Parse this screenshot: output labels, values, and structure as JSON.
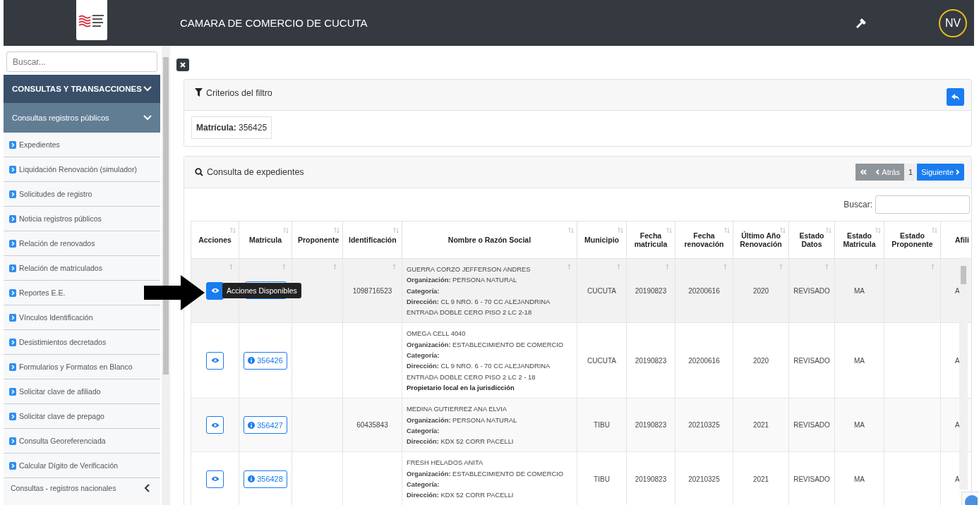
{
  "header": {
    "title": "CAMARA DE COMERCIO DE CUCUTA",
    "avatar": "NV"
  },
  "sidebar": {
    "search": {
      "placeholder": "Buscar..."
    },
    "section": {
      "label": "CONSULTAS Y TRANSACCIONES",
      "expanded": true
    },
    "subsection": {
      "label": "Consultas registros públicos",
      "expanded": true
    },
    "items": [
      "Expedientes",
      "Liquidación Renovación (simulador)",
      "Solicitudes de registro",
      "Noticia registros públicos",
      "Relación de renovados",
      "Relación de matriculados",
      "Reportes E.E.",
      "Vínculos Identificación",
      "Desistimientos decretados",
      "Formularios y Formatos en Blanco",
      "Solicitar clave de afiliado",
      "Solicitar clave de prepago",
      "Consulta Georeferenciada",
      "Calcular Dígito de Verificación"
    ],
    "next_section": {
      "label": "Consultas - registros nacionales",
      "expanded": false
    }
  },
  "filter": {
    "title": "Criterios del filtro",
    "criteria": [
      {
        "label": "Matrícula:",
        "value": "356425"
      }
    ]
  },
  "results": {
    "title": "Consulta de expedientes",
    "pagination": [
      {
        "kind": "first",
        "disabled": true
      },
      {
        "kind": "prev",
        "label": "Atrás",
        "disabled": true
      },
      {
        "kind": "page",
        "label": "1"
      },
      {
        "kind": "next",
        "label": "Siguiente",
        "disabled": false
      }
    ],
    "search_label": "Buscar:",
    "columns": [
      "Acciones",
      "Matricula",
      "Proponente",
      "Identificación",
      "Nombre o Razón Social",
      "Municipio",
      "Fecha matricula",
      "Fecha renovación",
      "Último Año Renovación",
      "Estado Datos",
      "Estado Matricula",
      "Estado Proponente",
      "Afili"
    ],
    "rows": [
      {
        "highlighted": true,
        "sort_marks": true,
        "tooltip": "Acciones Disponibles",
        "matricula": "",
        "proponente": "",
        "identificacion": "1098716523",
        "name": "GUERRA CORZO JEFFERSON ANDRES",
        "details": [
          {
            "label": "Organización:",
            "value": "PERSONA NATURAL"
          },
          {
            "label": "Categoría:"
          },
          {
            "label": "Dirección:",
            "value": "CL 9 NRO. 6 - 70 CC ALEJANDRINA ENTRADA DOBLE CERO PISO 2 LC 2-18"
          }
        ],
        "note": "",
        "municipio": "CUCUTA",
        "fecha_matricula": "20190823",
        "fecha_renovacion": "20200616",
        "ultimo_ano": "2020",
        "estado_datos": "REVISADO",
        "estado_matricula": "MA",
        "estado_proponente": "",
        "column_13": "A"
      },
      {
        "highlighted": false,
        "sort_marks": false,
        "matricula": "356426",
        "proponente": "",
        "identificacion": "",
        "name": "OMEGA CELL 4040",
        "details": [
          {
            "label": "Organización:",
            "value": "ESTABLECIMIENTO DE COMERCIO"
          },
          {
            "label": "Categoría:"
          },
          {
            "label": "Dirección:",
            "value": "CL 9 NRO. 6 - 70 CC ALEJANDRINA ENTRADA DOBLE CERO PISO 2 LC 2 - 18"
          }
        ],
        "note": "Propietario local en la jurisdicción",
        "municipio": "CUCUTA",
        "fecha_matricula": "20190823",
        "fecha_renovacion": "20200616",
        "ultimo_ano": "2020",
        "estado_datos": "REVISADO",
        "estado_matricula": "MA",
        "estado_proponente": "",
        "column_13": "A"
      },
      {
        "highlighted": false,
        "sort_marks": false,
        "matricula": "356427",
        "proponente": "",
        "identificacion": "60435843",
        "name": "MEDINA GUTIERREZ ANA ELVIA",
        "details": [
          {
            "label": "Organización:",
            "value": "PERSONA NATURAL"
          },
          {
            "label": "Categoría:"
          },
          {
            "label": "Dirección:",
            "value": "KDX 52 CORR PACELLI"
          }
        ],
        "note": "",
        "municipio": "TIBU",
        "fecha_matricula": "20190823",
        "fecha_renovacion": "20210325",
        "ultimo_ano": "2021",
        "estado_datos": "REVISADO",
        "estado_matricula": "MA",
        "estado_proponente": "",
        "column_13": "A"
      },
      {
        "highlighted": false,
        "sort_marks": false,
        "matricula": "356428",
        "proponente": "",
        "identificacion": "",
        "name": "FRESH HELADOS ANITA",
        "details": [
          {
            "label": "Organización:",
            "value": "ESTABLECIMIENTO DE COMERCIO"
          },
          {
            "label": "Categoría:"
          },
          {
            "label": "Dirección:",
            "value": "KDX 52 CORR PACELLI"
          }
        ],
        "note": "",
        "municipio": "TIBU",
        "fecha_matricula": "20190823",
        "fecha_renovacion": "20210325",
        "ultimo_ano": "2021",
        "estado_datos": "REVISADO",
        "estado_matricula": "MA",
        "estado_proponente": "",
        "column_13": "A"
      }
    ]
  }
}
